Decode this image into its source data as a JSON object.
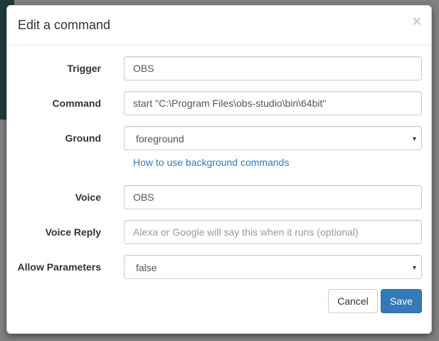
{
  "modal": {
    "title": "Edit a command",
    "close_label": "×"
  },
  "form": {
    "trigger": {
      "label": "Trigger",
      "value": "OBS"
    },
    "command": {
      "label": "Command",
      "value": "start \"C:\\Program Files\\obs-studio\\bin\\64bit\""
    },
    "ground": {
      "label": "Ground",
      "selected": "foreground",
      "help_link": "How to use background commands"
    },
    "voice": {
      "label": "Voice",
      "value": "OBS"
    },
    "voice_reply": {
      "label": "Voice Reply",
      "value": "",
      "placeholder": "Alexa or Google will say this when it runs (optional)"
    },
    "allow_parameters": {
      "label": "Allow Parameters",
      "selected": "false"
    }
  },
  "footer": {
    "cancel_label": "Cancel",
    "save_label": "Save"
  },
  "icons": {
    "select_caret": "▾"
  },
  "colors": {
    "primary": "#337ab7",
    "link": "#337ab7",
    "backdrop": "#7f8183"
  }
}
